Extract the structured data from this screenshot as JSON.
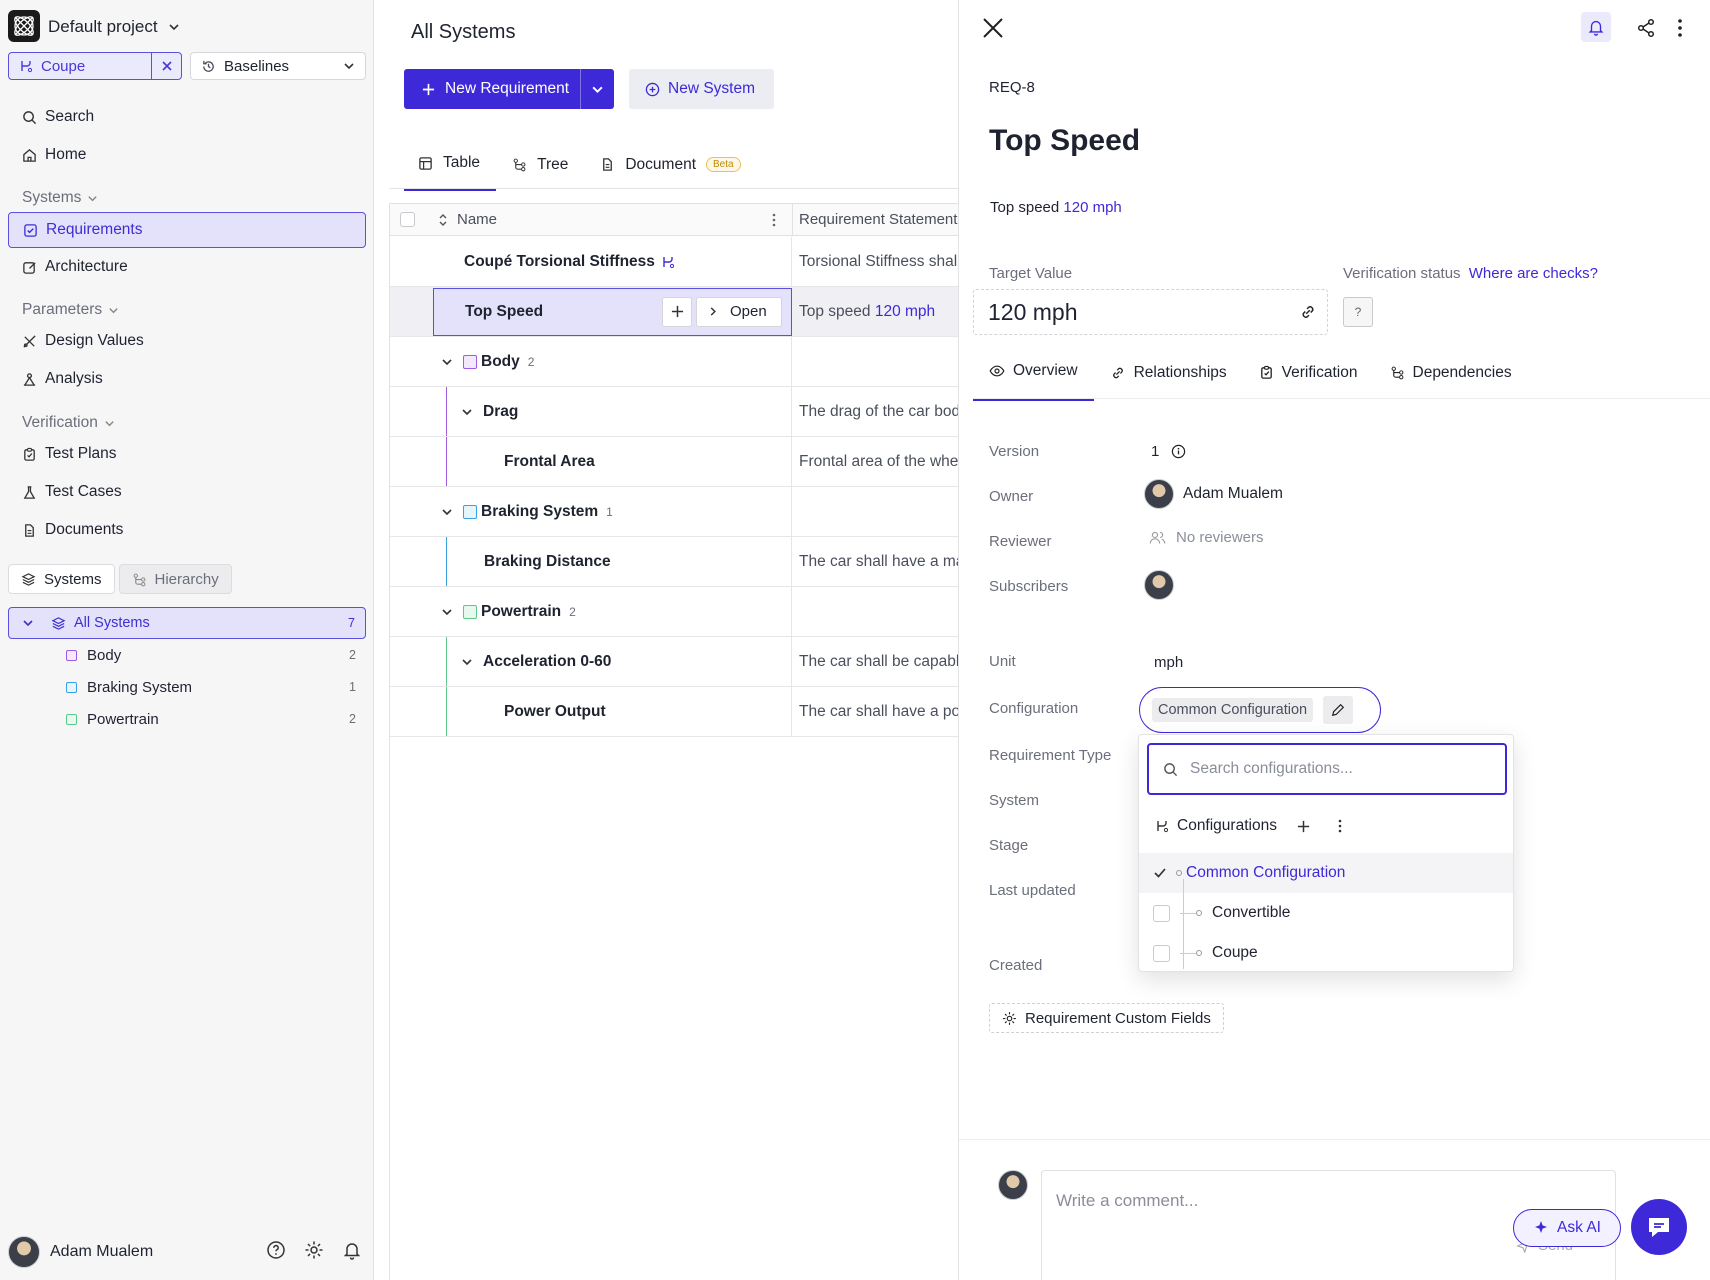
{
  "sidebar": {
    "project_name": "Default project",
    "config_chip": "Coupe",
    "baselines_label": "Baselines",
    "nav": {
      "search": "Search",
      "home": "Home",
      "systems_section": "Systems",
      "requirements": "Requirements",
      "architecture": "Architecture",
      "parameters_section": "Parameters",
      "design_values": "Design Values",
      "analysis": "Analysis",
      "verification_section": "Verification",
      "test_plans": "Test Plans",
      "test_cases": "Test Cases",
      "documents": "Documents"
    },
    "seg": {
      "systems": "Systems",
      "hierarchy": "Hierarchy"
    },
    "tree": {
      "all": {
        "label": "All Systems",
        "count": "7"
      },
      "items": [
        {
          "label": "Body",
          "count": "2",
          "color": "#a25be0"
        },
        {
          "label": "Braking System",
          "count": "1",
          "color": "#3aa0e0"
        },
        {
          "label": "Powertrain",
          "count": "2",
          "color": "#5cc98a"
        }
      ]
    },
    "user": "Adam Mualem"
  },
  "main": {
    "title": "All Systems",
    "new_requirement": "New Requirement",
    "new_system": "New System",
    "tabs": {
      "table": "Table",
      "tree": "Tree",
      "document": "Document",
      "beta": "Beta"
    },
    "columns": {
      "name": "Name",
      "statement": "Requirement Statement"
    },
    "rows": [
      {
        "name": "Coupé Torsional Stiffness",
        "statement": "Torsional Stiffness shall"
      },
      {
        "name": "Top Speed",
        "statement_prefix": "Top speed ",
        "statement_value": "120 mph",
        "open": "Open"
      },
      {
        "name": "Body",
        "count": "2"
      },
      {
        "name": "Drag",
        "statement": "The drag of the car body"
      },
      {
        "name": "Frontal Area",
        "statement": "Frontal area of the wheel"
      },
      {
        "name": "Braking System",
        "count": "1"
      },
      {
        "name": "Braking Distance",
        "statement": "The car shall have a max"
      },
      {
        "name": "Powertrain",
        "count": "2"
      },
      {
        "name": "Acceleration 0-60",
        "statement": "The car shall be capable"
      },
      {
        "name": "Power Output",
        "statement": "The car shall have a pow"
      }
    ]
  },
  "panel": {
    "id": "REQ-8",
    "title": "Top Speed",
    "statement_prefix": "Top speed ",
    "statement_value": "120 mph",
    "target_value_label": "Target Value",
    "target_value": "120 mph",
    "verification_label": "Verification status",
    "verification_link": "Where are checks?",
    "verification_badge": "?",
    "tabs": {
      "overview": "Overview",
      "relationships": "Relationships",
      "verification": "Verification",
      "dependencies": "Dependencies"
    },
    "fields": {
      "version_label": "Version",
      "version": "1",
      "owner_label": "Owner",
      "owner": "Adam Mualem",
      "reviewer_label": "Reviewer",
      "reviewer": "No reviewers",
      "subscribers_label": "Subscribers",
      "unit_label": "Unit",
      "unit": "mph",
      "configuration_label": "Configuration",
      "configuration": "Common Configuration",
      "req_type_label": "Requirement Type",
      "system_label": "System",
      "stage_label": "Stage",
      "last_updated_label": "Last updated",
      "created_label": "Created"
    },
    "custom_fields": "Requirement Custom Fields",
    "comment_placeholder": "Write a comment...",
    "send": "Send",
    "ask_ai": "Ask AI"
  },
  "config_popover": {
    "search_placeholder": "Search configurations...",
    "header": "Configurations",
    "items": [
      {
        "label": "Common Configuration",
        "selected": true
      },
      {
        "label": "Convertible",
        "selected": false
      },
      {
        "label": "Coupe",
        "selected": false
      }
    ]
  },
  "colors": {
    "accent": "#3e29d9",
    "accent_bg": "#e4e1fb"
  }
}
